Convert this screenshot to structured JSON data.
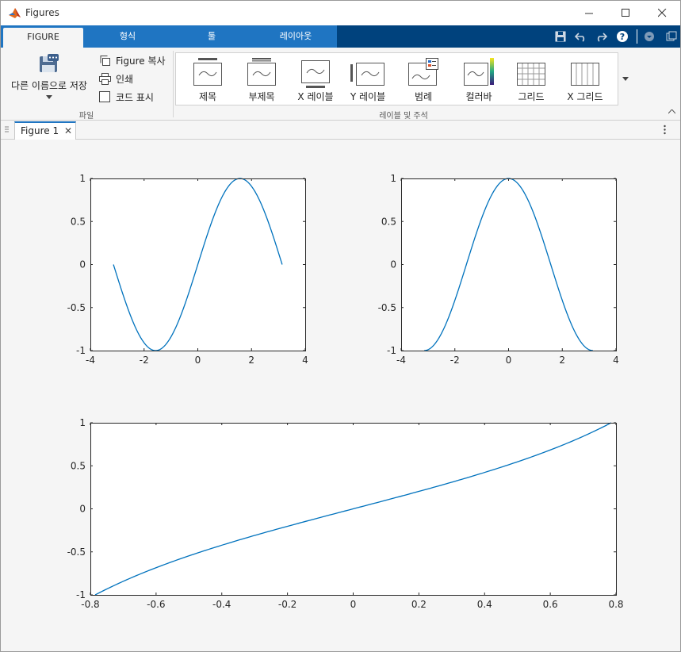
{
  "window": {
    "title": "Figures"
  },
  "ribbon_tabs": [
    {
      "label": "FIGURE",
      "active": true
    },
    {
      "label": "형식",
      "active": false
    },
    {
      "label": "툴",
      "active": false
    },
    {
      "label": "레이아웃",
      "active": false
    }
  ],
  "file_group": {
    "label": "파일",
    "save_as": "다른 이름으로 저장",
    "copy_figure": "Figure 복사",
    "print": "인쇄",
    "show_code": "코드 표시"
  },
  "labels_group": {
    "label": "레이블 및 주석",
    "items": [
      "제목",
      "부제목",
      "X 레이블",
      "Y 레이블",
      "범례",
      "컬러바",
      "그리드",
      "X 그리드"
    ]
  },
  "document_tab": {
    "label": "Figure 1"
  },
  "colors": {
    "line": "#0072BD",
    "tab_blue": "#1f75c2",
    "tab_dark": "#00427d"
  },
  "chart_data": [
    {
      "type": "line",
      "function": "sin(x)",
      "x_range": [
        -3.1416,
        3.1416
      ],
      "xlim": [
        -4,
        4
      ],
      "ylim": [
        -1,
        1
      ],
      "xticks": [
        -4,
        -2,
        0,
        2,
        4
      ],
      "yticks": [
        -1,
        -0.5,
        0,
        0.5,
        1
      ],
      "xticklabels": [
        "-4",
        "-2",
        "0",
        "2",
        "4"
      ],
      "yticklabels": [
        "-1",
        "-0.5",
        "0",
        "0.5",
        "1"
      ]
    },
    {
      "type": "line",
      "function": "cos(x)",
      "x_range": [
        -3.1416,
        3.1416
      ],
      "xlim": [
        -4,
        4
      ],
      "ylim": [
        -1,
        1
      ],
      "xticks": [
        -4,
        -2,
        0,
        2,
        4
      ],
      "yticks": [
        -1,
        -0.5,
        0,
        0.5,
        1
      ],
      "xticklabels": [
        "-4",
        "-2",
        "0",
        "2",
        "4"
      ],
      "yticklabels": [
        "-1",
        "-0.5",
        "0",
        "0.5",
        "1"
      ]
    },
    {
      "type": "line",
      "function": "tan(x)",
      "x_range": [
        -0.7854,
        0.7854
      ],
      "xlim": [
        -0.8,
        0.8
      ],
      "ylim": [
        -1,
        1
      ],
      "xticks": [
        -0.8,
        -0.6,
        -0.4,
        -0.2,
        0,
        0.2,
        0.4,
        0.6,
        0.8
      ],
      "yticks": [
        -1,
        -0.5,
        0,
        0.5,
        1
      ],
      "xticklabels": [
        "-0.8",
        "-0.6",
        "-0.4",
        "-0.2",
        "0",
        "0.2",
        "0.4",
        "0.6",
        "0.8"
      ],
      "yticklabels": [
        "-1",
        "-0.5",
        "0",
        "0.5",
        "1"
      ]
    }
  ]
}
